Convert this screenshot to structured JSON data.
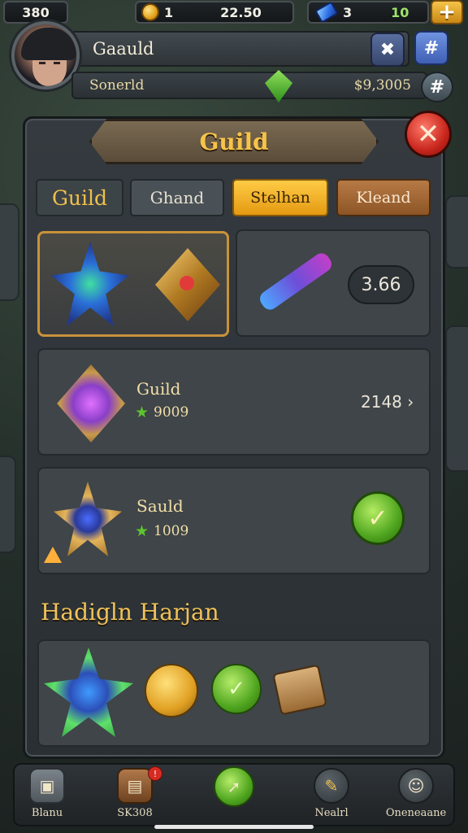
{
  "topbar": {
    "left_value": "380",
    "coin_value": "1",
    "timer": "22.50",
    "gem_value": "3",
    "energy_value": "10",
    "plus_label": "+"
  },
  "header": {
    "player_name": "Gaauld",
    "sub_label": "Sonerld",
    "currency_value": "$9,3005"
  },
  "panel": {
    "title": "Guild",
    "close_label": "✕",
    "tabs": [
      {
        "label": "Guild"
      },
      {
        "label": "Ghand"
      },
      {
        "label": "Stelhan"
      },
      {
        "label": "Kleand"
      }
    ]
  },
  "items": {
    "featured_value": "3.66",
    "row1": {
      "name": "Guild",
      "stat": "9009",
      "right_value": "2148 ›"
    },
    "row2": {
      "name": "Sauld",
      "stat": "1009"
    }
  },
  "section": {
    "title": "Hadigln Harjan"
  },
  "bottom_nav": [
    {
      "label": "Blanu"
    },
    {
      "label": "SK308"
    },
    {
      "label": ""
    },
    {
      "label": "Nealrl"
    },
    {
      "label": "Oneneaane"
    }
  ],
  "colors": {
    "gold": "#f0c04a",
    "tab_active": "#ffcb45",
    "close_red": "#c8261c",
    "confirm_green": "#4fa51f"
  }
}
